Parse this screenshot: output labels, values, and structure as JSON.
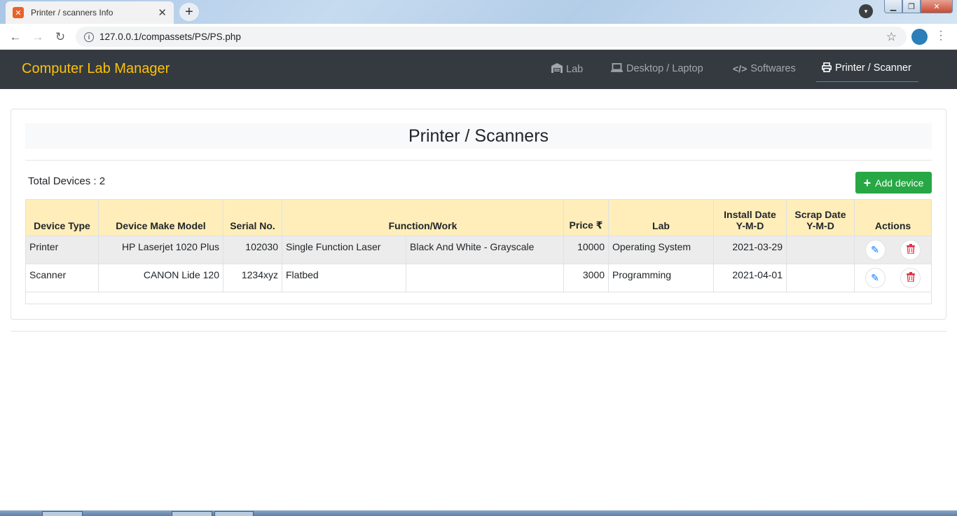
{
  "browser": {
    "tab_title": "Printer / scanners Info",
    "favicon": "xampp-icon",
    "url": "127.0.0.1/compassets/PS/PS.php",
    "new_tab": "+",
    "close_tab": "✕"
  },
  "navbar": {
    "brand": "Computer Lab Manager",
    "brand_color": "#ffc107",
    "items": [
      {
        "label": "Lab",
        "icon": "warehouse-icon"
      },
      {
        "label": "Desktop / Laptop",
        "icon": "laptop-icon"
      },
      {
        "label": "Softwares",
        "icon": "code-icon"
      },
      {
        "label": "Printer / Scanner",
        "icon": "printer-icon",
        "active": true
      }
    ]
  },
  "page": {
    "title": "Printer / Scanners",
    "total_label": "Total Devices : 2",
    "add_button": "Add device"
  },
  "table": {
    "headers": {
      "device_type": "Device Type",
      "make_model": "Device Make Model",
      "serial": "Serial No.",
      "function": "Function/Work",
      "price": "Price ₹",
      "lab": "Lab",
      "install_1": "Install Date",
      "install_2": "Y-M-D",
      "scrap_1": "Scrap Date",
      "scrap_2": "Y-M-D",
      "actions": "Actions"
    },
    "rows": [
      {
        "device_type": "Printer",
        "make_model": "HP Laserjet 1020 Plus",
        "serial": "102030",
        "function": "Single Function Laser",
        "work": "Black And White - Grayscale",
        "price": "10000",
        "lab": "Operating System",
        "install_date": "2021-03-29",
        "scrap_date": ""
      },
      {
        "device_type": "Scanner",
        "make_model": "CANON Lide 120",
        "serial": "1234xyz",
        "function": "Flatbed",
        "work": "",
        "price": "3000",
        "lab": "Programming",
        "install_date": "2021-04-01",
        "scrap_date": ""
      }
    ]
  }
}
